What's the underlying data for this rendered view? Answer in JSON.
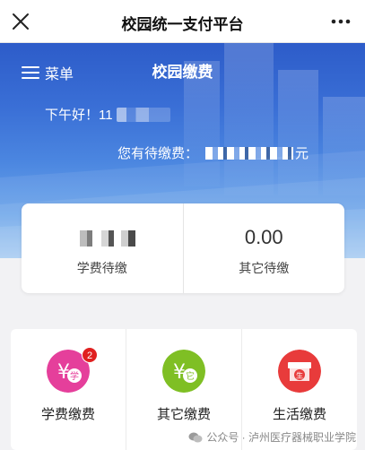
{
  "topbar": {
    "title": "校园统一支付平台"
  },
  "hero": {
    "menu_label": "菜单",
    "title": "校园缴费",
    "greeting": "下午好！11",
    "pending_label": "您有待缴费：",
    "pending_unit": "元"
  },
  "summary": {
    "tuition_label": "学费待缴",
    "other_amount": "0.00",
    "other_label": "其它待缴"
  },
  "services": [
    {
      "label": "学费缴费",
      "icon": "tuition-icon",
      "color": "#e53f9b",
      "badge": "2"
    },
    {
      "label": "其它缴费",
      "icon": "other-fee-icon",
      "color": "#7fbf24"
    },
    {
      "label": "生活缴费",
      "icon": "shop-icon",
      "color": "#e83b3b"
    }
  ],
  "watermark": "公众号 · 泸州医疗器械职业学院"
}
